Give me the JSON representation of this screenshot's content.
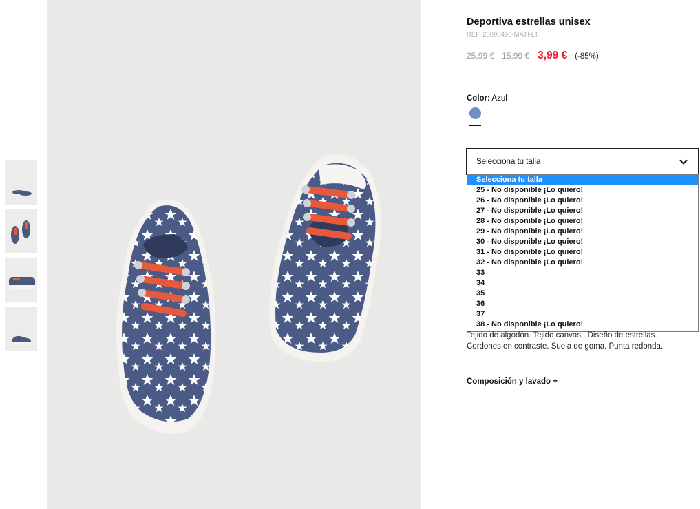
{
  "product": {
    "title": "Deportiva estrellas unisex",
    "ref": "REF. 23090496-MATI-LT",
    "prices": {
      "original": "25,99 €",
      "previous": "15,99 €",
      "current": "3,99 €",
      "discount": "(-85%)"
    },
    "color": {
      "label": "Color:",
      "value": "Azul",
      "swatch_hex": "#6b8fc9"
    },
    "size_select": {
      "placeholder": "Selecciona tu talla",
      "options": [
        "Selecciona tu talla",
        "25 - No disponible ¡Lo quiero!",
        "26 - No disponible ¡Lo quiero!",
        "27 - No disponible ¡Lo quiero!",
        "28 - No disponible ¡Lo quiero!",
        "29 - No disponible ¡Lo quiero!",
        "30 - No disponible ¡Lo quiero!",
        "31 - No disponible ¡Lo quiero!",
        "32 - No disponible ¡Lo quiero!",
        "33",
        "34",
        "35",
        "36",
        "37",
        "38 - No disponible ¡Lo quiero!"
      ],
      "highlighted_index": 0
    },
    "description_line1": "Tejido de algodón. Tejido canvas . Diseño de estrellas.",
    "description_line2": "Cordones en contraste. Suela de goma. Punta redonda.",
    "composition_label": "Composición y lavado  +"
  },
  "colors": {
    "price_red": "#e5202e",
    "highlight_blue": "#1e90ff",
    "image_bg": "#e9e9e7"
  },
  "icons": {
    "chevron": "chevron-down-icon"
  }
}
